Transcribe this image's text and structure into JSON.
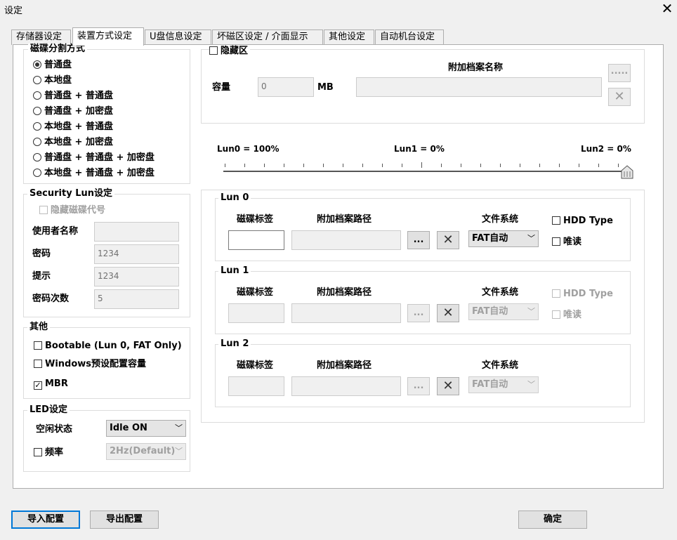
{
  "window": {
    "title": "设定",
    "close_glyph": "✕"
  },
  "tabs": [
    {
      "label": "存储器设定"
    },
    {
      "label": "装置方式设定"
    },
    {
      "label": "U盘信息设定"
    },
    {
      "label": "坏磁区设定 / 介面显示"
    },
    {
      "label": "其他设定"
    },
    {
      "label": "自动机台设定"
    }
  ],
  "active_tab": "装置方式设定",
  "partition": {
    "title": "磁碟分割方式",
    "options": [
      {
        "label": "普通盘",
        "selected": true
      },
      {
        "label": "本地盘",
        "selected": false
      },
      {
        "label": "普通盘 + 普通盘",
        "selected": false
      },
      {
        "label": "普通盘 + 加密盘",
        "selected": false
      },
      {
        "label": "本地盘 + 普通盘",
        "selected": false
      },
      {
        "label": "本地盘 + 加密盘",
        "selected": false
      },
      {
        "label": "普通盘 + 普通盘 + 加密盘",
        "selected": false
      },
      {
        "label": "本地盘 + 普通盘 + 加密盘",
        "selected": false
      }
    ]
  },
  "security": {
    "title": "Security Lun设定",
    "hide_code_label": "隐藏磁碟代号",
    "username_label": "使用者名称",
    "username_value": "",
    "password_label": "密码",
    "password_value": "1234",
    "hint_label": "提示",
    "hint_value": "1234",
    "tries_label": "密码次数",
    "tries_value": "5"
  },
  "other": {
    "title": "其他",
    "bootable_label": "Bootable (Lun 0, FAT Only)",
    "bootable_checked": false,
    "windows_label": "Windows预设配置容量",
    "windows_checked": false,
    "mbr_label": "MBR",
    "mbr_checked": true
  },
  "led": {
    "title": "LED设定",
    "idle_label": "空闲状态",
    "idle_value": "Idle ON",
    "freq_label": "频率",
    "freq_checked": false,
    "freq_value": "2Hz(Default)"
  },
  "hidden": {
    "checkbox_label": "隐藏区",
    "checked": false,
    "capacity_label": "容量",
    "capacity_value": "0",
    "unit": "MB",
    "attach_name_label": "附加档案名称",
    "attach_name_value": "",
    "browse_label": ".....",
    "clear_glyph": "✕"
  },
  "slider": {
    "lun0": "Lun0 = 100%",
    "lun1": "Lun1 = 0%",
    "lun2": "Lun2 = 0%",
    "position_fraction": 1.0
  },
  "luns": [
    {
      "title": "Lun 0",
      "enabled": true,
      "label_header": "磁碟标签",
      "label_value": "",
      "path_header": "附加档案路径",
      "path_value": "",
      "browse_label": "...",
      "clear_glyph": "✕",
      "fs_header": "文件系统",
      "fs_value": "FAT自动",
      "hdd_label": "HDD Type",
      "hdd_checked": false,
      "ro_label": "唯读",
      "ro_checked": false
    },
    {
      "title": "Lun 1",
      "enabled": false,
      "label_header": "磁碟标签",
      "label_value": "",
      "path_header": "附加档案路径",
      "path_value": "",
      "browse_label": "...",
      "clear_glyph": "✕",
      "fs_header": "文件系统",
      "fs_value": "FAT自动",
      "hdd_label": "HDD Type",
      "hdd_checked": false,
      "ro_label": "唯读",
      "ro_checked": false
    },
    {
      "title": "Lun 2",
      "enabled": false,
      "label_header": "磁碟标签",
      "label_value": "",
      "path_header": "附加档案路径",
      "path_value": "",
      "browse_label": "...",
      "clear_glyph": "✕",
      "fs_header": "文件系统",
      "fs_value": "FAT自动"
    }
  ],
  "footer": {
    "import_label": "导入配置",
    "export_label": "导出配置",
    "ok_label": "确定"
  },
  "icons": {
    "dropdown": "chevron-down-icon",
    "close": "close-icon",
    "clear": "x-icon"
  },
  "colors": {
    "focus": "#0078d7",
    "panel": "#ffffff",
    "window": "#f0f0f0"
  }
}
